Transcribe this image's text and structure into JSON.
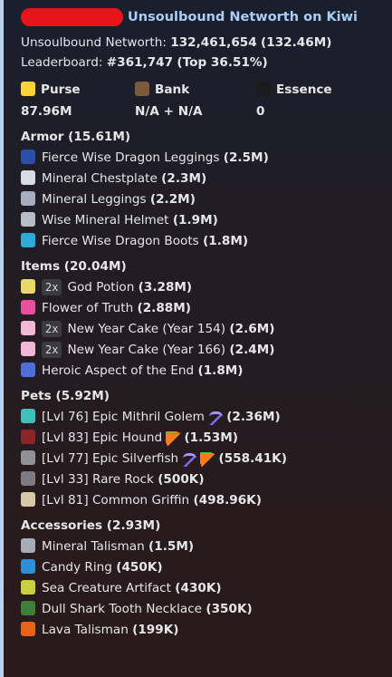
{
  "header": {
    "title": "Unsoulbound Networth on Kiwi",
    "networth_label": "Unsoulbound Networth:",
    "networth_value": "132,461,654",
    "networth_short": "(132.46M)",
    "leaderboard_label": "Leaderboard:",
    "leaderboard_value": "#361,747",
    "leaderboard_top": "(Top 36.51%)"
  },
  "stats": [
    {
      "name": "Purse",
      "value": "87.96M",
      "icon": "purse-icon",
      "color": "#ffd23a"
    },
    {
      "name": "Bank",
      "value": "N/A + N/A",
      "icon": "bank-icon",
      "color": "#7a5a3a"
    },
    {
      "name": "Essence",
      "value": "0",
      "icon": "essence-icon",
      "color": "#1b1b1b"
    }
  ],
  "sections": [
    {
      "title": "Armor (15.61M)",
      "items": [
        {
          "qty": "",
          "name": "Fierce Wise Dragon Leggings",
          "value": "(2.5M)",
          "icon": "leggings-icon",
          "color": "#2b4ea8",
          "extras": []
        },
        {
          "qty": "",
          "name": "Mineral Chestplate",
          "value": "(2.3M)",
          "icon": "chestplate-icon",
          "color": "#d8dae6",
          "extras": []
        },
        {
          "qty": "",
          "name": "Mineral Leggings",
          "value": "(2.2M)",
          "icon": "leggings-icon",
          "color": "#a9acbf",
          "extras": []
        },
        {
          "qty": "",
          "name": "Wise Mineral Helmet",
          "value": "(1.9M)",
          "icon": "helmet-icon",
          "color": "#b9bccb",
          "extras": []
        },
        {
          "qty": "",
          "name": "Fierce Wise Dragon Boots",
          "value": "(1.8M)",
          "icon": "boots-icon",
          "color": "#2fa9d6",
          "extras": []
        }
      ]
    },
    {
      "title": "Items (20.04M)",
      "items": [
        {
          "qty": "2x",
          "name": "God Potion",
          "value": "(3.28M)",
          "icon": "god-potion-icon",
          "color": "#e8d96a",
          "extras": []
        },
        {
          "qty": "",
          "name": "Flower of Truth",
          "value": "(2.88M)",
          "icon": "flower-icon",
          "color": "#e84f9c",
          "extras": []
        },
        {
          "qty": "2x",
          "name": "New Year Cake (Year 154)",
          "value": "(2.6M)",
          "icon": "cake-icon",
          "color": "#f2b7d5",
          "extras": []
        },
        {
          "qty": "2x",
          "name": "New Year Cake (Year 166)",
          "value": "(2.4M)",
          "icon": "cake-icon",
          "color": "#f2b7d5",
          "extras": []
        },
        {
          "qty": "",
          "name": "Heroic Aspect of the End",
          "value": "(1.8M)",
          "icon": "sword-icon",
          "color": "#4e6fd6",
          "extras": []
        }
      ]
    },
    {
      "title": "Pets (5.92M)",
      "items": [
        {
          "qty": "",
          "name": "[Lvl 76] Epic Mithril Golem",
          "value": "(2.36M)",
          "icon": "mithril-golem-icon",
          "color": "#3fc0b8",
          "extras": [
            "pickaxe-icon"
          ]
        },
        {
          "qty": "",
          "name": "[Lvl 83] Epic Hound",
          "value": "(1.53M)",
          "icon": "hound-icon",
          "color": "#8a2626",
          "extras": [
            "carrot-icon"
          ]
        },
        {
          "qty": "",
          "name": "[Lvl 77] Epic Silverfish",
          "value": "(558.41K)",
          "icon": "silverfish-icon",
          "color": "#8f9098",
          "extras": [
            "pickaxe-icon",
            "carrot-icon"
          ]
        },
        {
          "qty": "",
          "name": "[Lvl 33] Rare Rock",
          "value": "(500K)",
          "icon": "rock-icon",
          "color": "#7c7c80",
          "extras": []
        },
        {
          "qty": "",
          "name": "[Lvl 81] Common Griffin",
          "value": "(498.96K)",
          "icon": "griffin-icon",
          "color": "#d6c8a6",
          "extras": []
        }
      ]
    },
    {
      "title": "Accessories (2.93M)",
      "items": [
        {
          "qty": "",
          "name": "Mineral Talisman",
          "value": "(1.5M)",
          "icon": "mineral-talisman-icon",
          "color": "#a7adb8",
          "extras": []
        },
        {
          "qty": "",
          "name": "Candy Ring",
          "value": "(450K)",
          "icon": "candy-ring-icon",
          "color": "#2f8fd6",
          "extras": []
        },
        {
          "qty": "",
          "name": "Sea Creature Artifact",
          "value": "(430K)",
          "icon": "sea-creature-artifact-icon",
          "color": "#c8d040",
          "extras": []
        },
        {
          "qty": "",
          "name": "Dull Shark Tooth Necklace",
          "value": "(350K)",
          "icon": "shark-necklace-icon",
          "color": "#3e7f3a",
          "extras": []
        },
        {
          "qty": "",
          "name": "Lava Talisman",
          "value": "(199K)",
          "icon": "lava-talisman-icon",
          "color": "#e8631a",
          "extras": []
        }
      ]
    }
  ]
}
